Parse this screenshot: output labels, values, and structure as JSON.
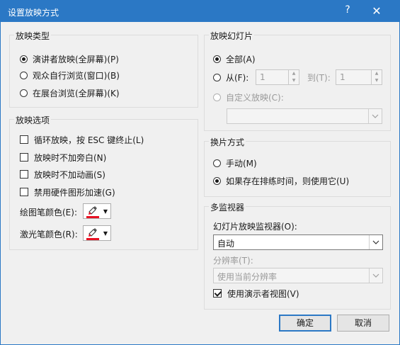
{
  "window": {
    "title": "设置放映方式",
    "help": "?",
    "close": "✕"
  },
  "show_type": {
    "legend": "放映类型",
    "options": [
      "演讲者放映(全屏幕)(P)",
      "观众自行浏览(窗口)(B)",
      "在展台浏览(全屏幕)(K)"
    ],
    "selected": 0
  },
  "show_options": {
    "legend": "放映选项",
    "checks": [
      {
        "label": "循环放映，按 ESC 键终止(L)",
        "checked": false
      },
      {
        "label": "放映时不加旁白(N)",
        "checked": false
      },
      {
        "label": "放映时不加动画(S)",
        "checked": false
      },
      {
        "label": "禁用硬件图形加速(G)",
        "checked": false
      }
    ],
    "pen_color_label": "绘图笔颜色(E):",
    "laser_color_label": "激光笔颜色(R):",
    "pen_color": "#e81123",
    "laser_color": "#e81123"
  },
  "slides": {
    "legend": "放映幻灯片",
    "all_label": "全部(A)",
    "from_label": "从(F):",
    "from_value": "1",
    "to_label": "到(T):",
    "to_value": "1",
    "custom_label": "自定义放映(C):",
    "custom_value": ""
  },
  "advance": {
    "legend": "换片方式",
    "manual_label": "手动(M)",
    "timing_label": "如果存在排练时间，则使用它(U)",
    "selected": 1
  },
  "monitors": {
    "legend": "多监视器",
    "monitor_label": "幻灯片放映监视器(O):",
    "monitor_value": "自动",
    "resolution_label": "分辨率(T):",
    "resolution_value": "使用当前分辨率",
    "presenter_view_label": "使用演示者视图(V)",
    "presenter_view_checked": true
  },
  "buttons": {
    "ok": "确定",
    "cancel": "取消"
  }
}
